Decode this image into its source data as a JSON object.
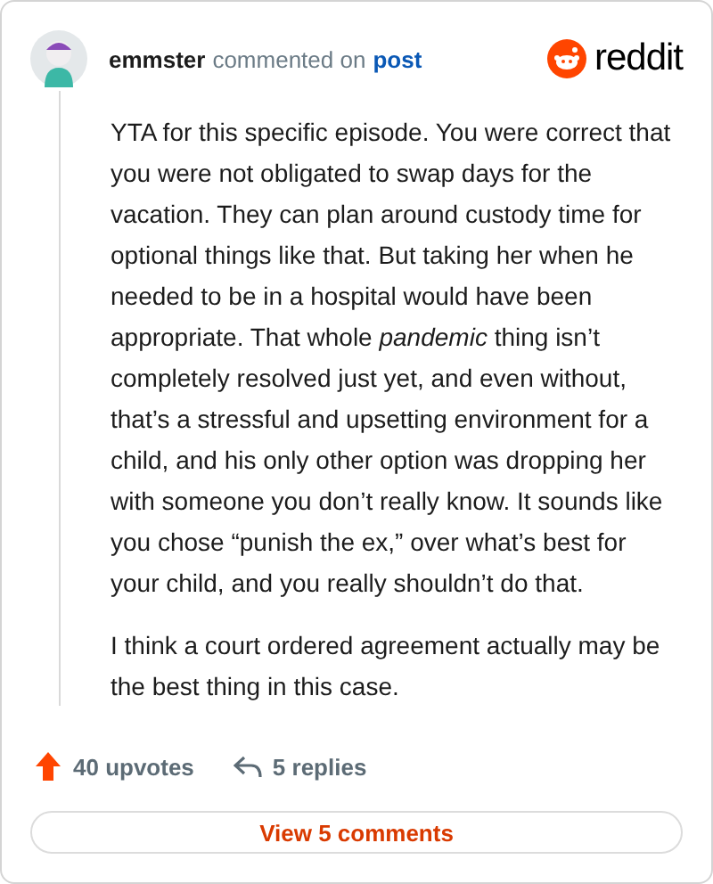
{
  "header": {
    "username": "emmster",
    "action": "commented on",
    "target": "post",
    "brand": "reddit"
  },
  "comment": {
    "paragraphs": [
      "YTA for this specific episode. You were correct that you were not obligated to swap days for the vacation. They can plan around custody time for optional things like that. But taking her when he needed to be in a hospital would have been appropriate. That whole *pandemic* thing isn’t completely resolved just yet, and even without, that’s a stressful and upsetting environment for a child, and his only other option was dropping her with someone you don’t really know. It sounds like you chose “punish the ex,” over what’s best for your child, and you really shouldn’t do that.",
      "I think a court ordered agreement actually may be the best thing in this case."
    ]
  },
  "stats": {
    "upvotes": "40 upvotes",
    "replies": "5 replies"
  },
  "view_button": "View 5 comments"
}
